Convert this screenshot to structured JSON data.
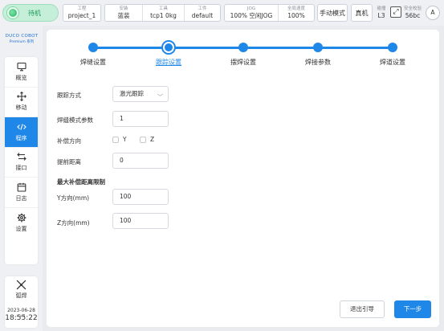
{
  "status": {
    "text": "待机",
    "color": "#27b463"
  },
  "topbar": {
    "project": {
      "key": "工程",
      "value": "project_1"
    },
    "install": {
      "key": "安装",
      "value": "蓝装"
    },
    "tool": {
      "key": "工具",
      "value": "tcp1   0kg"
    },
    "workpiece": {
      "key": "工件",
      "value": "default"
    },
    "jog": {
      "key": "JOG",
      "value": "100%  空闲JOG"
    },
    "global_speed": {
      "key": "全局速度",
      "value": "100%"
    },
    "mode_button": "手动模式",
    "real_button": "真机",
    "brake": {
      "key": "碰撞",
      "value": "L3"
    },
    "safety_icon": "expand-icon",
    "safety": {
      "key": "安全校验",
      "value": "56bc"
    },
    "user_initials": "A"
  },
  "logo": {
    "line1": "DUCO COBOT",
    "line2": "Premium 系列"
  },
  "sidebar": {
    "items": [
      {
        "label": "概览",
        "icon": "monitor-icon",
        "active": false
      },
      {
        "label": "移动",
        "icon": "move-icon",
        "active": false
      },
      {
        "label": "程序",
        "icon": "code-icon",
        "active": true
      },
      {
        "label": "接口",
        "icon": "interface-icon",
        "active": false
      },
      {
        "label": "日志",
        "icon": "calendar-icon",
        "active": false
      },
      {
        "label": "设置",
        "icon": "gear-icon",
        "active": false
      }
    ],
    "tools": [
      {
        "label": "弧焊",
        "icon": "welding-icon"
      },
      {
        "label": "...",
        "icon": "more-icon"
      }
    ]
  },
  "clock": {
    "date": "2023-06-28",
    "time": "18:55:22"
  },
  "stepper": {
    "steps": [
      "焊缝设置",
      "跟踪设置",
      "摆焊设置",
      "焊接参数",
      "焊道设置"
    ],
    "current_index": 1
  },
  "form": {
    "tracking_mode": {
      "label": "跟踪方式",
      "value": "激光跟踪"
    },
    "weld_mode_param": {
      "label": "焊缝模式参数",
      "value": "1"
    },
    "comp_direction": {
      "label": "补偿方向",
      "options": [
        "Y",
        "Z"
      ]
    },
    "advance_distance": {
      "label": "提前距离",
      "value": "0"
    },
    "max_comp_header": "最大补偿距离限制",
    "y_direction": {
      "label": "Y方向(mm)",
      "value": "100"
    },
    "z_direction": {
      "label": "Z方向(mm)",
      "value": "100"
    }
  },
  "buttons": {
    "exit_guide": "退出引导",
    "next": "下一步"
  },
  "colors": {
    "accent": "#1f87e8",
    "status_green": "#27b463"
  }
}
